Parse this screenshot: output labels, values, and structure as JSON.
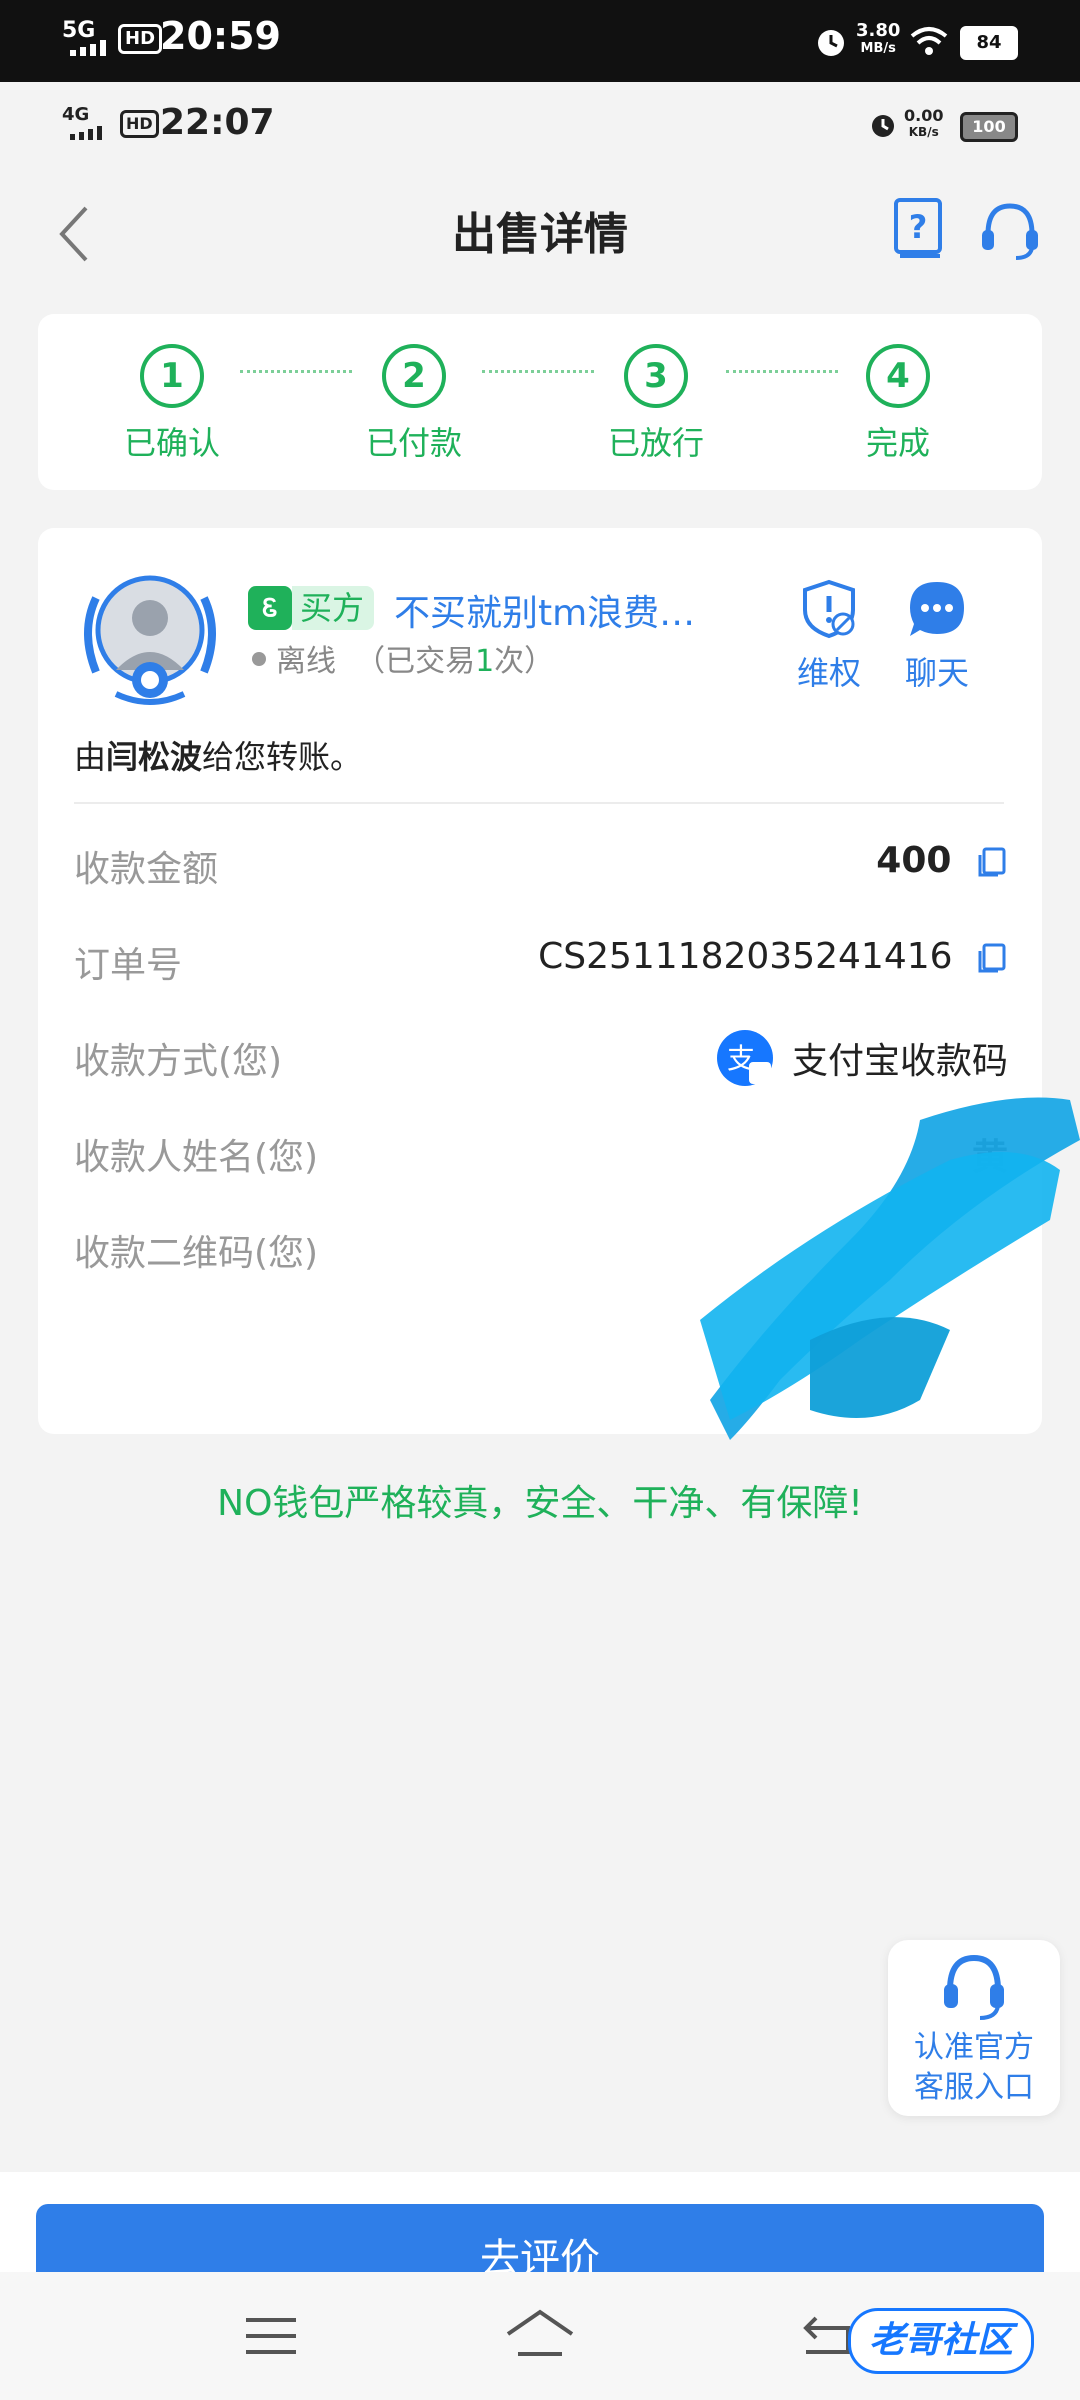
{
  "outer_status": {
    "network": "5G",
    "hd": "HD",
    "time": "20:59",
    "speed_value": "3.80",
    "speed_unit": "MB/s",
    "battery": "84"
  },
  "inner_status": {
    "network": "4G",
    "hd": "HD",
    "time": "22:07",
    "speed_value": "0.00",
    "speed_unit": "KB/s",
    "battery": "100"
  },
  "header": {
    "title": "出售详情"
  },
  "steps": [
    {
      "num": "1",
      "label": "已确认"
    },
    {
      "num": "2",
      "label": "已付款"
    },
    {
      "num": "3",
      "label": "已放行"
    },
    {
      "num": "4",
      "label": "完成"
    }
  ],
  "buyer": {
    "role_tag": "买方",
    "name": "不买就别tm浪费…",
    "status": "离线",
    "trades_prefix": "（已交易",
    "trades_count": "1",
    "trades_suffix": "次）"
  },
  "actions": {
    "protect": "维权",
    "chat": "聊天"
  },
  "transfer": {
    "prefix": "由",
    "name": "闫松波",
    "suffix": "给您转账。"
  },
  "details": {
    "amount_label": "收款金额",
    "amount_value": "400",
    "order_label": "订单号",
    "order_value": "CS2511182035241416",
    "method_label": "收款方式(您)",
    "method_value": "支付宝收款码",
    "payee_label": "收款人姓名(您)",
    "payee_value": "黄",
    "qr_label": "收款二维码(您)"
  },
  "slogan": "NO钱包严格较真，安全、干净、有保障!",
  "cs_float": {
    "line1": "认准官方",
    "line2": "客服入口"
  },
  "review_button": "去评价",
  "watermark": "老哥社区",
  "colors": {
    "accent_blue": "#2f7ee8",
    "accent_green": "#1fb15a"
  }
}
